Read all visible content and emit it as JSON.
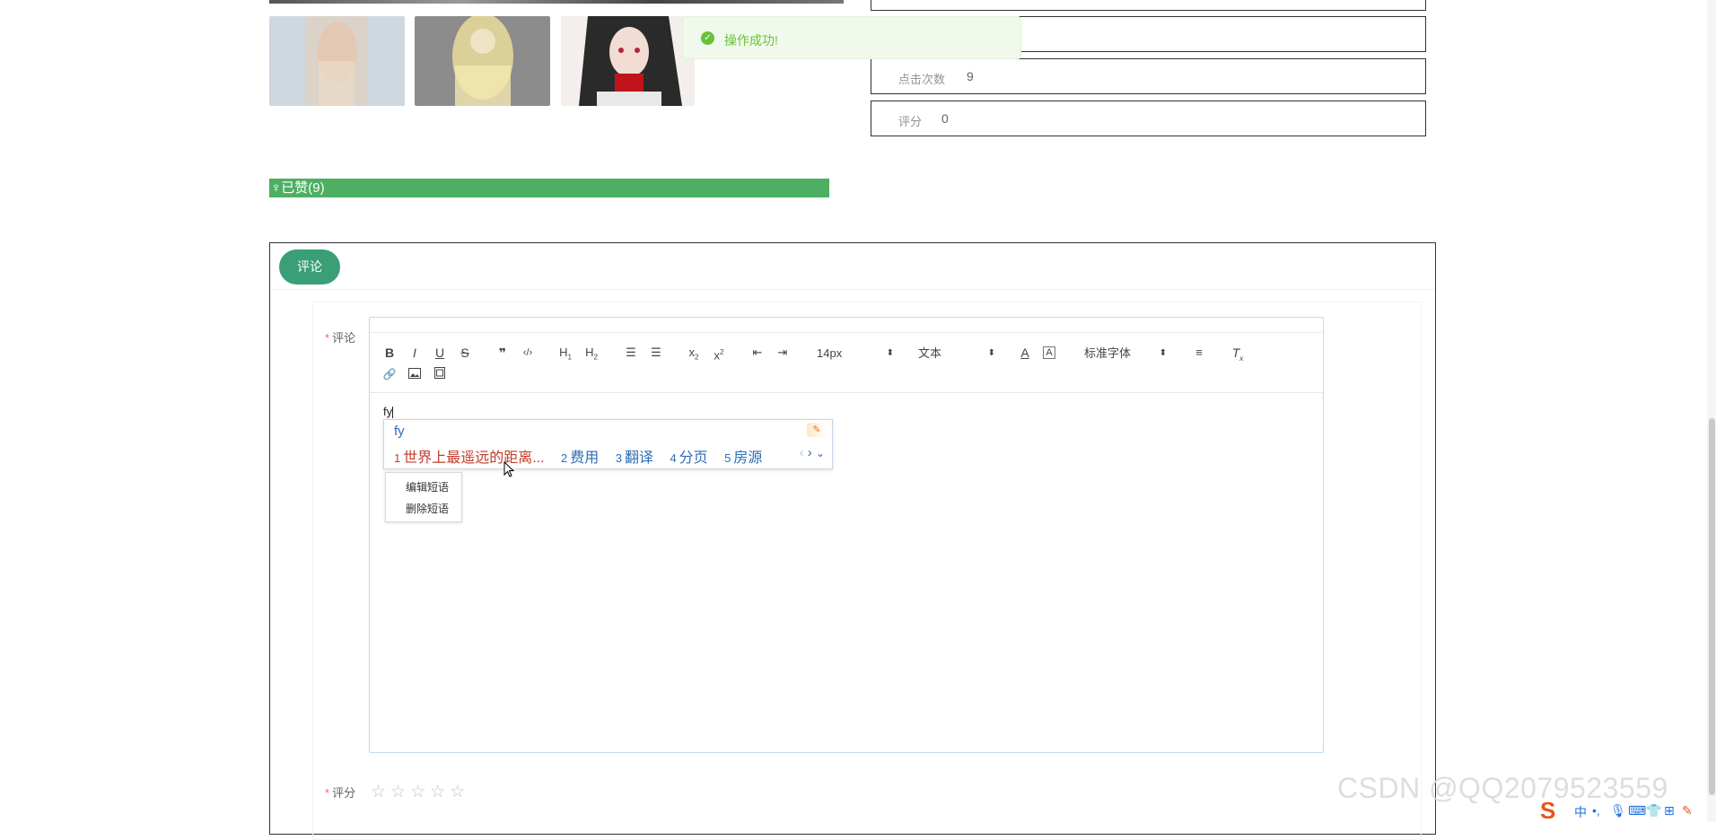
{
  "toast": {
    "message": "操作成功!"
  },
  "info": {
    "clicks_label": "点击次数",
    "clicks_value": "9",
    "rating_label": "评分",
    "rating_value": "0"
  },
  "like": {
    "icon": "thumb-up-icon",
    "label": "已赞(9)"
  },
  "comment_card": {
    "tab_label": "评论"
  },
  "form": {
    "comment_label": "评论",
    "rating_label": "评分",
    "required_mark": "*"
  },
  "editor": {
    "font_size": "14px",
    "paragraph": "文本",
    "font_family": "标准字体",
    "content": "fy",
    "toolbar": [
      "B",
      "I",
      "U",
      "S",
      "❞",
      "</>",
      "H1",
      "H2",
      "ol",
      "ul",
      "x₂",
      "x²",
      "outdent",
      "indent",
      "A",
      "A-bg",
      "align",
      "Tx",
      "link",
      "image",
      "video"
    ]
  },
  "ime": {
    "pinyin": "fy",
    "candidates": [
      {
        "n": "1",
        "text": "世界上最遥远的距离..."
      },
      {
        "n": "2",
        "text": "费用"
      },
      {
        "n": "3",
        "text": "翻译"
      },
      {
        "n": "4",
        "text": "分页"
      },
      {
        "n": "5",
        "text": "房源"
      }
    ],
    "menu": [
      "编辑短语",
      "删除短语"
    ]
  },
  "watermark": "CSDN @QQ2079523559",
  "tray": {
    "lang": "中"
  },
  "colors": {
    "accent_green": "#3a9f77",
    "like_green": "#4caf61",
    "success": "#67c23a",
    "ime_blue": "#2d6db5",
    "ime_red": "#c23c2a"
  }
}
